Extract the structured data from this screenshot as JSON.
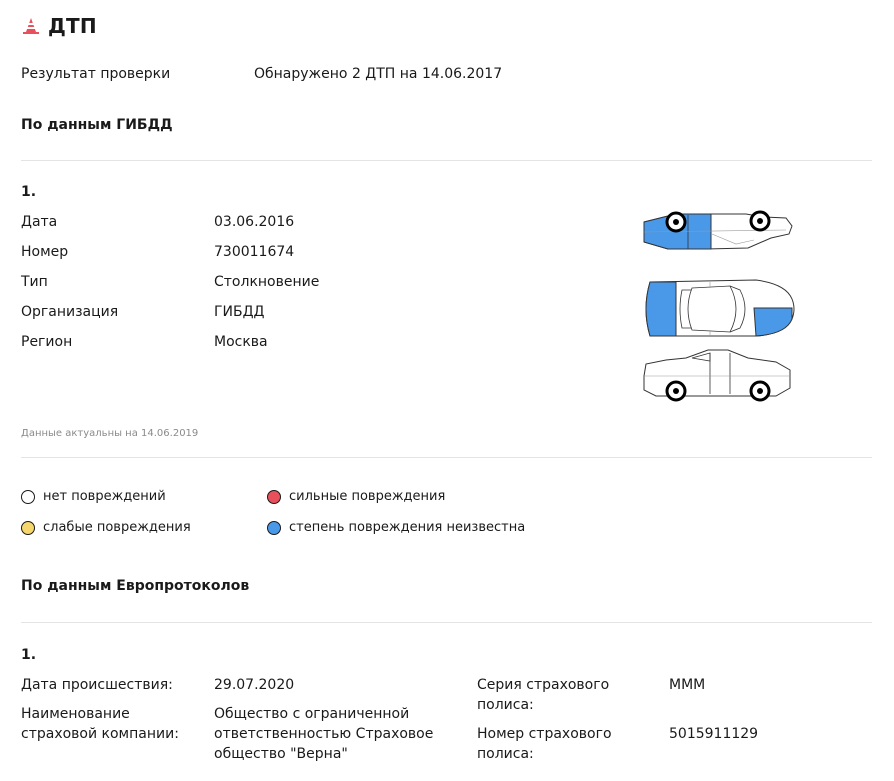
{
  "header": {
    "title": "ДТП"
  },
  "result": {
    "label": "Результат проверки",
    "value": "Обнаружено 2 ДТП на 14.06.2017"
  },
  "gibdd": {
    "heading": "По данным ГИБДД",
    "index": "1.",
    "rows": [
      {
        "label": "Дата",
        "value": "03.06.2016"
      },
      {
        "label": "Номер",
        "value": "730011674"
      },
      {
        "label": "Тип",
        "value": "Столкновение"
      },
      {
        "label": "Организация",
        "value": "ГИБДД"
      },
      {
        "label": "Регион",
        "value": "Москва"
      }
    ],
    "actual": "Данные актуальны на 14.06.2019"
  },
  "legend": {
    "none": {
      "label": "нет повреждений",
      "color": "#ffffff"
    },
    "strong": {
      "label": "сильные повреждения",
      "color": "#e8505b"
    },
    "light": {
      "label": "слабые повреждения",
      "color": "#f5d76e"
    },
    "unknown": {
      "label": "степень повреждения неизвестна",
      "color": "#4a98e8"
    }
  },
  "euro": {
    "heading": "По данным Европротоколов",
    "index": "1.",
    "date_label": "Дата происшествия:",
    "date_value": "29.07.2020",
    "company_label": "Наименование страховой компании:",
    "company_value": "Общество с ограниченной ответственностью Страховое общество \"Верна\"",
    "series_label": "Серия страхового полиса:",
    "series_value": "МММ",
    "number_label": "Номер страхового полиса:",
    "number_value": "5015911129"
  }
}
